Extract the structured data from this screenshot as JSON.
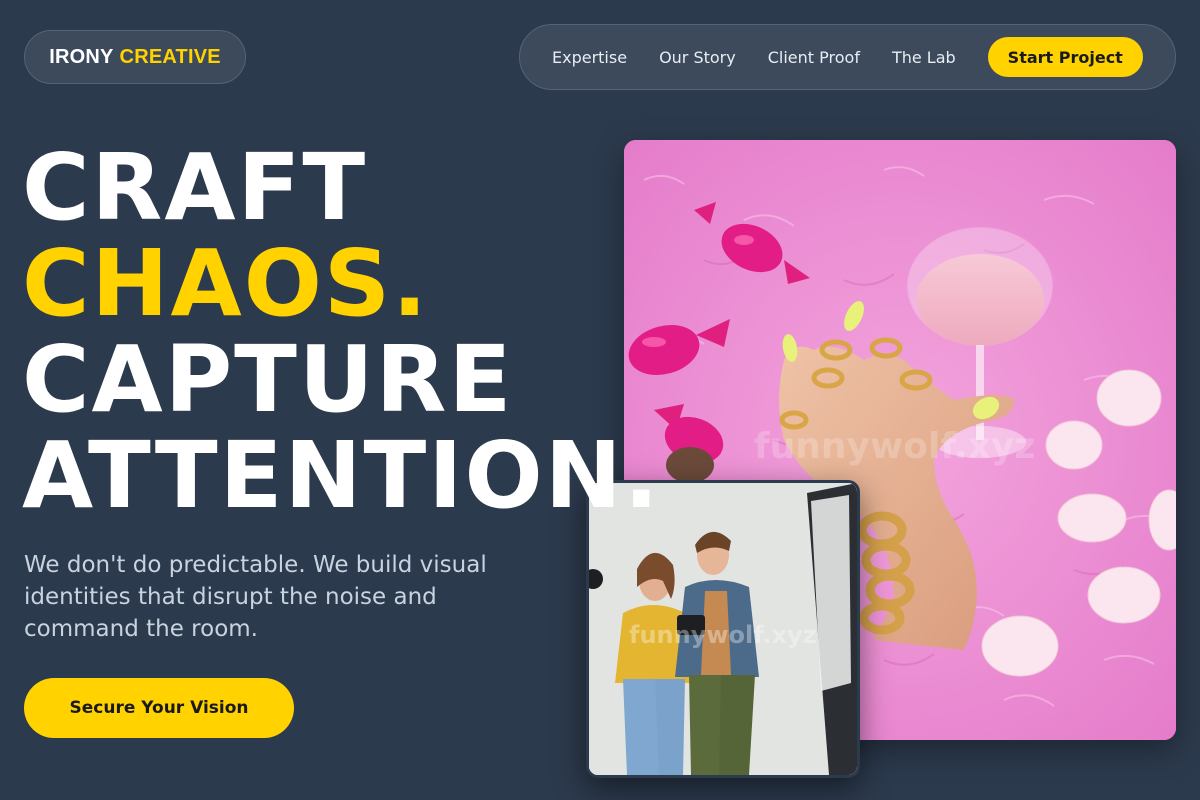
{
  "brand": {
    "word1": "IRONY",
    "word2": "CREATIVE"
  },
  "nav": {
    "links": [
      "Expertise",
      "Our Story",
      "Client Proof",
      "The Lab"
    ],
    "cta": "Start Project"
  },
  "hero": {
    "headline": [
      "CRAFT",
      "CHAOS.",
      "CAPTURE",
      "ATTENTION."
    ],
    "subtext": "We don't do predictable. We build visual identities that disrupt the noise and command the room.",
    "cta": "Secure Your Vision"
  },
  "images": {
    "main_watermark": "funnywolf.xyz",
    "small_watermark": "funnywolf.xyz"
  },
  "colors": {
    "background": "#2c3a4d",
    "accent": "#ffd200",
    "pill_bg": "#3d4a5c"
  }
}
